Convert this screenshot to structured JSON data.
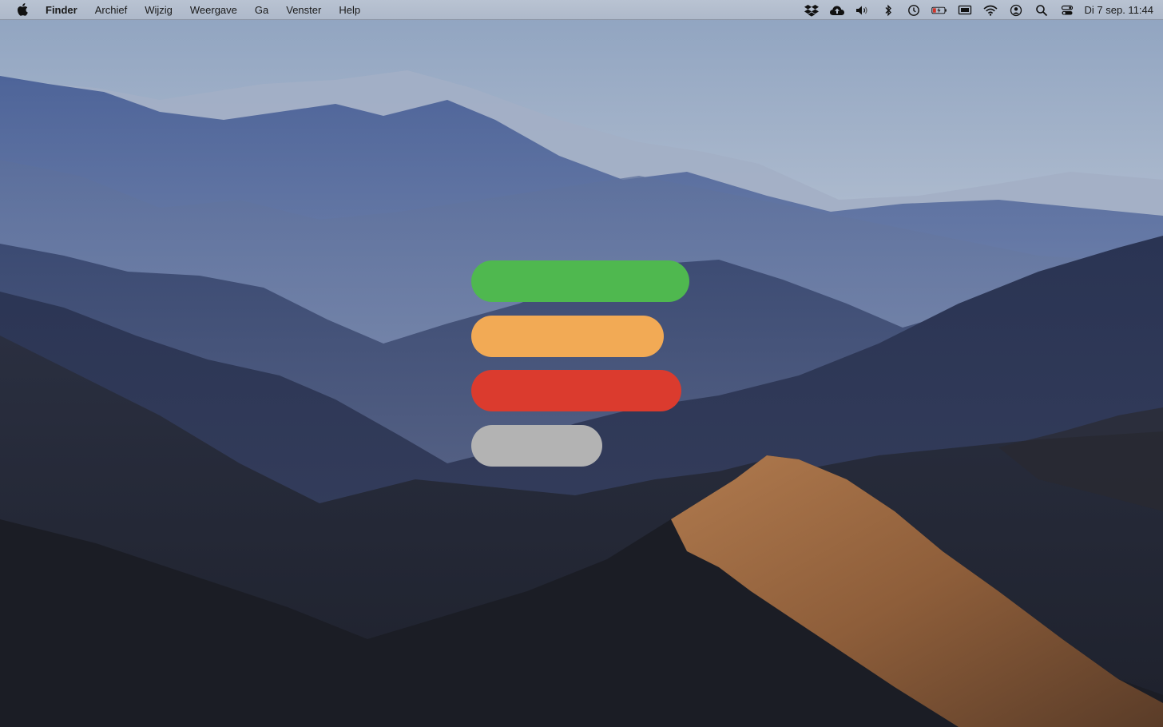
{
  "menubar": {
    "apple_icon": "apple-icon",
    "app_name": "Finder",
    "menus": [
      "Archief",
      "Wijzig",
      "Weergave",
      "Ga",
      "Venster",
      "Help"
    ],
    "status_icons": [
      "dropbox-icon",
      "cloud-upload-icon",
      "volume-icon",
      "bluetooth-icon",
      "time-machine-icon",
      "battery-icon",
      "display-icon",
      "wifi-icon",
      "user-icon",
      "search-icon",
      "control-center-icon"
    ],
    "clock": "Di 7 sep. 11:44"
  },
  "status_bars": [
    {
      "name": "green-bar",
      "color": "#4fb84f",
      "relative_length": 1.0
    },
    {
      "name": "orange-bar",
      "color": "#f2aa55",
      "relative_length": 0.88
    },
    {
      "name": "red-bar",
      "color": "#db3b2e",
      "relative_length": 0.96
    },
    {
      "name": "gray-bar",
      "color": "#b3b3b3",
      "relative_length": 0.6
    }
  ]
}
